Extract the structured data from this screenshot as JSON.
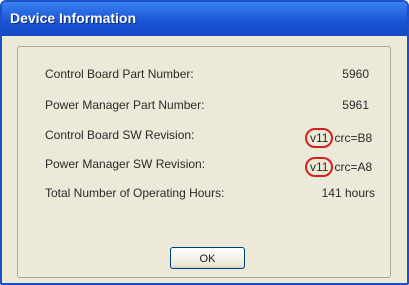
{
  "window": {
    "title": "Device Information"
  },
  "rows": [
    {
      "label": "Control Board Part Number:",
      "value": "5960"
    },
    {
      "label": "Power Manager Part Number:",
      "value": "5961"
    },
    {
      "label": "Control Board SW Revision:",
      "version": "v11",
      "crc": "crc=B8"
    },
    {
      "label": "Power Manager SW Revision:",
      "version": "v11",
      "crc": "crc=A8"
    },
    {
      "label": "Total Number of Operating Hours:",
      "value": "141 hours"
    }
  ],
  "buttons": {
    "ok_label": "OK"
  },
  "colors": {
    "titlebar": "#1a55d6",
    "highlight_circle": "#d62020",
    "dialog_bg": "#ece9d8"
  }
}
